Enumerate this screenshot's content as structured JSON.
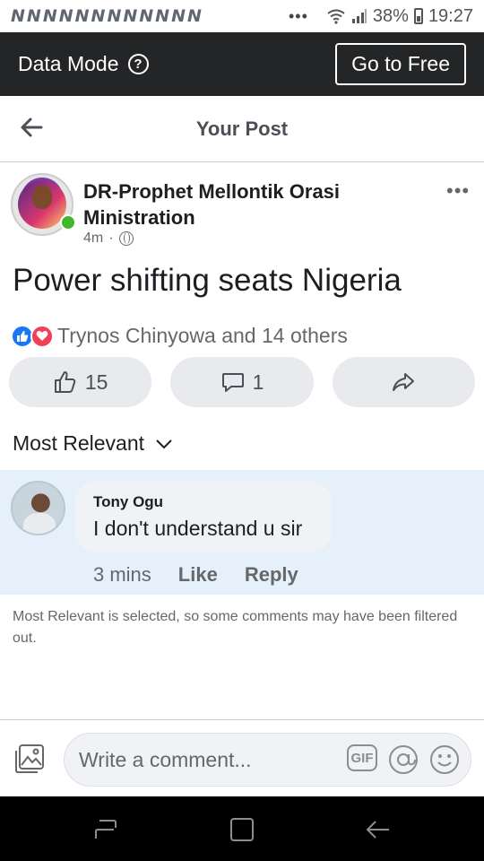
{
  "status_bar": {
    "notifications": [
      "N",
      "N",
      "N",
      "N",
      "N",
      "N",
      "N",
      "N",
      "N",
      "N",
      "N",
      "N"
    ],
    "more": "•••",
    "battery": "38%",
    "time": "19:27"
  },
  "data_bar": {
    "label": "Data Mode",
    "help": "?",
    "free_button": "Go to Free"
  },
  "header": {
    "title": "Your Post"
  },
  "post": {
    "author": "DR-Prophet Mellontik Orasi Ministration",
    "time": "4m",
    "separator": "·",
    "text": "Power shifting seats Nigeria",
    "reactions_text": "Trynos Chinyowa and 14 others",
    "like_count": "15",
    "comment_count": "1",
    "more": "•••"
  },
  "comments": {
    "sort_label": "Most Relevant",
    "items": [
      {
        "author": "Tony Ogu",
        "text": "I don't understand u sir",
        "time": "3 mins",
        "like": "Like",
        "reply": "Reply"
      }
    ],
    "filtered_note": "Most Relevant is selected, so some comments may have been filtered out."
  },
  "composer": {
    "placeholder": "Write a comment...",
    "gif": "GIF"
  },
  "colors": {
    "data_bar_bg": "#242526",
    "like_blue": "#1877f2",
    "love_red": "#f33e58",
    "online_green": "#42b72a",
    "comment_highlight": "#e6f0fb"
  }
}
